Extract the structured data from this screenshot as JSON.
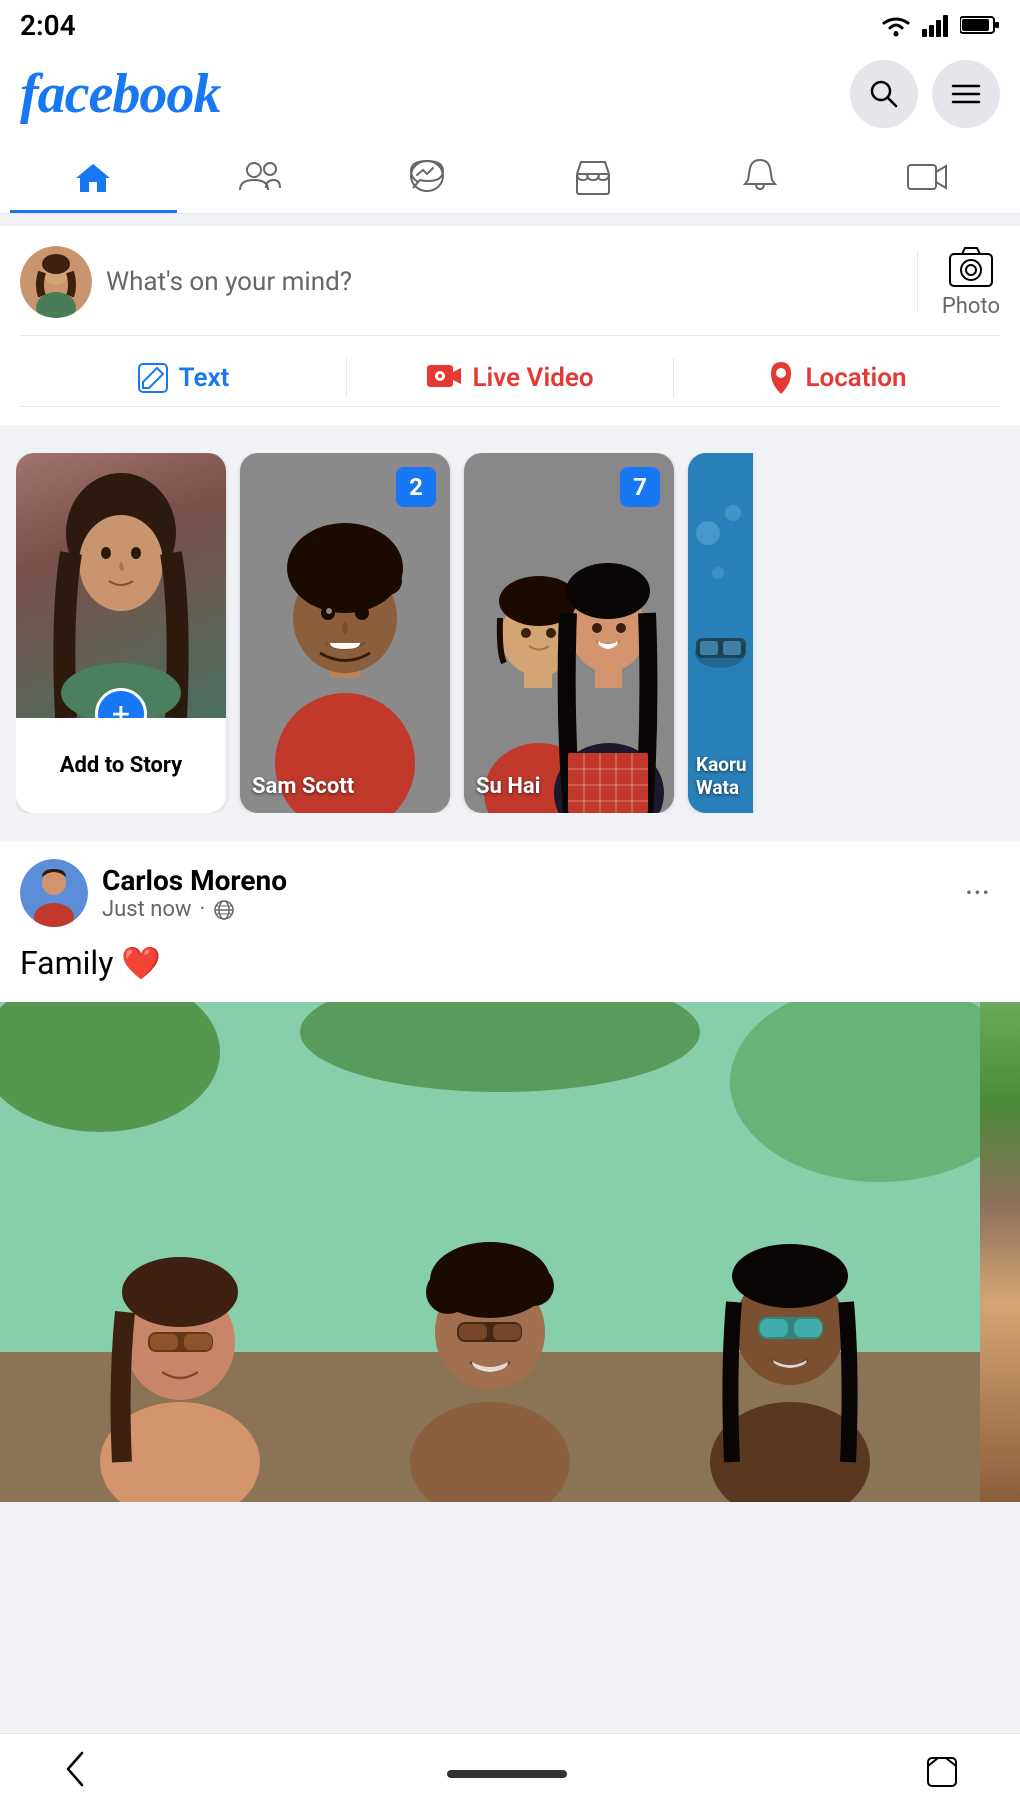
{
  "statusBar": {
    "time": "2:04",
    "icons": [
      "wifi",
      "signal",
      "battery"
    ]
  },
  "header": {
    "logo": "facebook",
    "searchLabel": "search",
    "menuLabel": "menu"
  },
  "navTabs": {
    "tabs": [
      {
        "id": "home",
        "label": "Home",
        "active": true
      },
      {
        "id": "friends",
        "label": "Friends",
        "active": false
      },
      {
        "id": "messenger",
        "label": "Messenger",
        "active": false
      },
      {
        "id": "marketplace",
        "label": "Marketplace",
        "active": false
      },
      {
        "id": "notifications",
        "label": "Notifications",
        "active": false
      },
      {
        "id": "video",
        "label": "Video",
        "active": false
      }
    ]
  },
  "postInput": {
    "placeholder": "What's on your mind?",
    "photoLabel": "Photo"
  },
  "actions": {
    "text": "Text",
    "liveVideo": "Live Video",
    "location": "Location"
  },
  "stories": [
    {
      "id": "add-story",
      "label": "Add to Story",
      "type": "add"
    },
    {
      "id": "sam-scott",
      "name": "Sam Scott",
      "badge": "2",
      "type": "person"
    },
    {
      "id": "su-hai",
      "name": "Su Hai",
      "badge": "7",
      "type": "person"
    },
    {
      "id": "kaoru-wata",
      "name": "Kaoru Wata",
      "type": "partial"
    }
  ],
  "post": {
    "author": "Carlos Moreno",
    "time": "Just now",
    "privacy": "Public",
    "content": "Family ❤️",
    "moreButtonLabel": "···"
  },
  "bottomNav": {
    "backLabel": "‹",
    "recentLabel": "⎕"
  }
}
